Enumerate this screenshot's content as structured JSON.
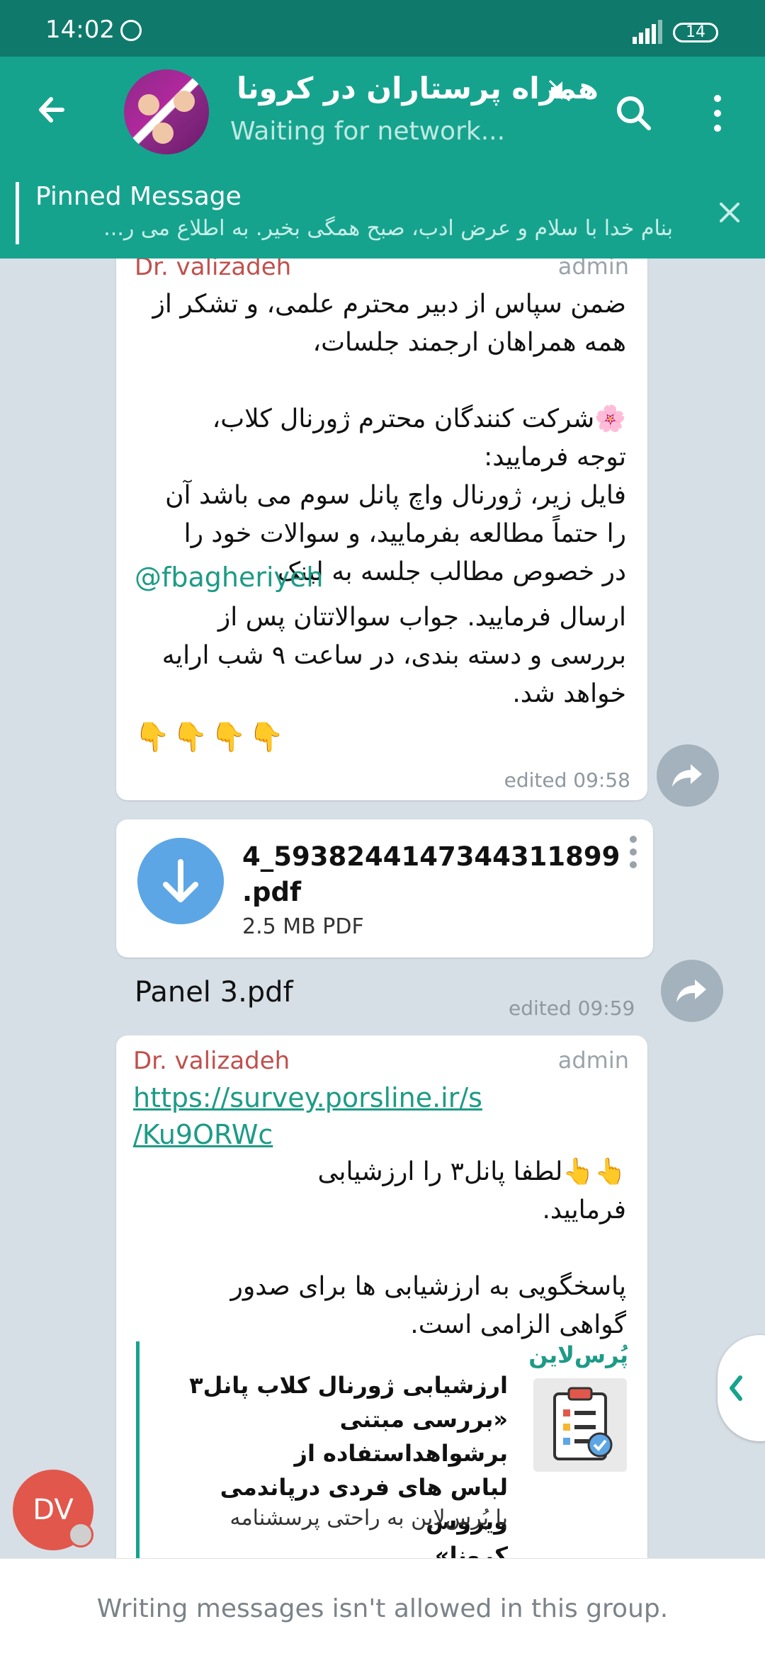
{
  "status_bar": {
    "time": "14:02",
    "battery": "14"
  },
  "header": {
    "title": "همراه پرستاران در کرونا",
    "status": "Waiting for network..."
  },
  "pinned": {
    "label": "Pinned Message",
    "preview": "بنام خدا با سلام و عرض ادب، صبح همگی بخیر. به اطلاع می ر..."
  },
  "messages": [
    {
      "sender": "Dr. valizadeh",
      "role": "admin",
      "text_a": "ضمن سپاس از دبیر محترم علمی، و تشکر از\nهمه همراهان ارجمند جلسات،\n\n🌸شرکت کنندگان محترم ژورنال کلاب،\nتوجه فرمایید:\nفایل زیر، ژورنال واچ پانل سوم می باشد آن\nرا حتماً مطالعه بفرمایید، و سوالات خود را\nدر خصوص مطالب جلسه به لینک",
      "mention": "@fbagheriyeh",
      "text_b": "ارسال فرمایید. جواب سوالاتتان پس از\nبررسی و دسته بندی، در ساعت ۹ شب ارایه\nخواهد شد.",
      "emoji": "👇👇👇👇",
      "edited": "edited 09:58"
    },
    {
      "file_name": "4_5938244147344311899\n.pdf",
      "file_size": "2.5 MB PDF",
      "caption": "Panel 3.pdf",
      "edited": "edited 09:59"
    },
    {
      "sender": "Dr. valizadeh",
      "role": "admin",
      "link": "https://survey.porsline.ir/s\n/Ku9ORWc",
      "text": "👆👆لطفا پانل۳ را ارزشیابی\nفرمایید.\n\nپاسخگویی به ارزشیابی ها برای صدور\nگواهی الزامی است.",
      "preview_site": "پُرس‌لاین",
      "preview_title": "ارزشیابی ژورنال کلاب پانل۳\n«بررسی مبتنی برشواهداستفاده از\nلباس های فردی درپاندمی ویروس\nکرونا»",
      "preview_desc": "با پُرس‌لاین به راحتی پرسشنامه"
    }
  ],
  "user_avatar": {
    "initials": "DV"
  },
  "bottom_bar": {
    "notice": "Writing messages isn't allowed in this group."
  },
  "colors": {
    "primary": "#16a38e",
    "status_bar": "#0f7a6c",
    "sender": "#c0504d",
    "link": "#1d9b86"
  }
}
